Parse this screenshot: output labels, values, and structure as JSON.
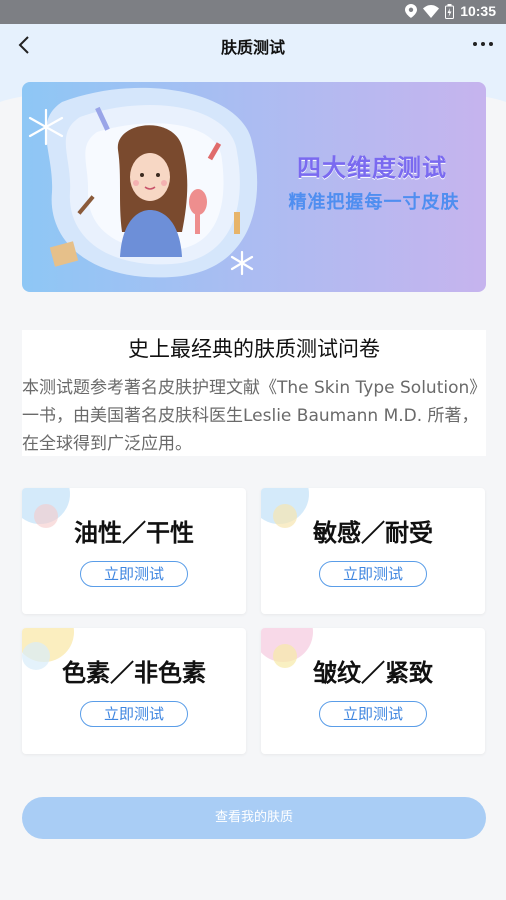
{
  "status_bar": {
    "time": "10:35"
  },
  "header": {
    "title": "肤质测试"
  },
  "banner": {
    "line1": "四大维度测试",
    "line2": "精准把握每一寸皮肤"
  },
  "intro": {
    "title": "史上最经典的肤质测试问卷",
    "description": "本测试题参考著名皮肤护理文献《The Skin Type Solution》一书，由美国著名皮肤科医生Leslie Baumann M.D. 所著，在全球得到广泛应用。"
  },
  "cards": [
    {
      "title": "油性／干性",
      "button": "立即测试",
      "accent": "#9fd0f5",
      "accent2": "#f5c9c9"
    },
    {
      "title": "敏感／耐受",
      "button": "立即测试",
      "accent": "#9fd0f5",
      "accent2": "#f7e6b0"
    },
    {
      "title": "色素／非色素",
      "button": "立即测试",
      "accent": "#f7e08a",
      "accent2": "#d8ecf9"
    },
    {
      "title": "皱纹／紧致",
      "button": "立即测试",
      "accent": "#f2b3d2",
      "accent2": "#f7eaa8"
    }
  ],
  "bottom_button": "查看我的肤质",
  "colors": {
    "accent": "#3f86e0",
    "header_bg": "#e6f1fd",
    "bottom_button": "#a9cdf5"
  }
}
